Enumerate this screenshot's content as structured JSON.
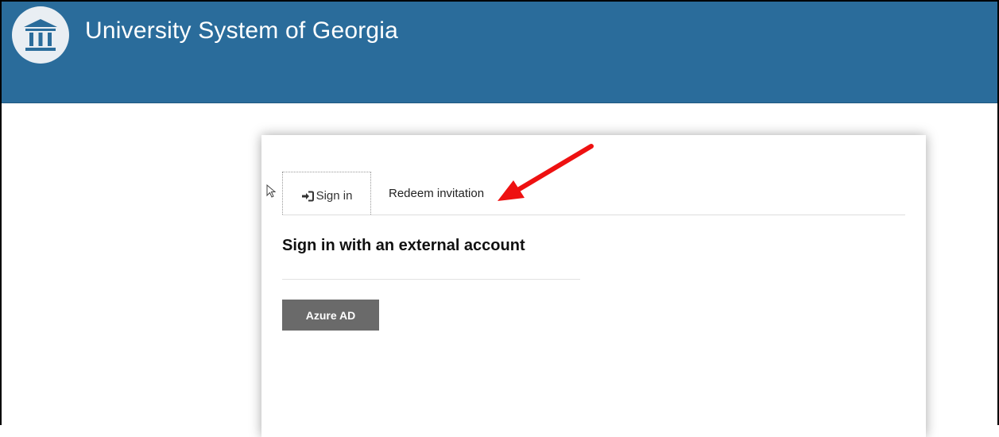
{
  "header": {
    "title": "University System of Georgia",
    "background_color": "#2a6c9b",
    "logo_icon": "building-columns-icon"
  },
  "tabs": [
    {
      "label": "Sign in",
      "icon": "sign-in-icon",
      "active": true
    },
    {
      "label": "Redeem invitation",
      "active": false
    }
  ],
  "main": {
    "heading": "Sign in with an external account",
    "providers": [
      {
        "label": "Azure AD"
      }
    ]
  },
  "annotations": {
    "arrow_color": "#ee1111",
    "arrow_target": "Redeem invitation"
  }
}
